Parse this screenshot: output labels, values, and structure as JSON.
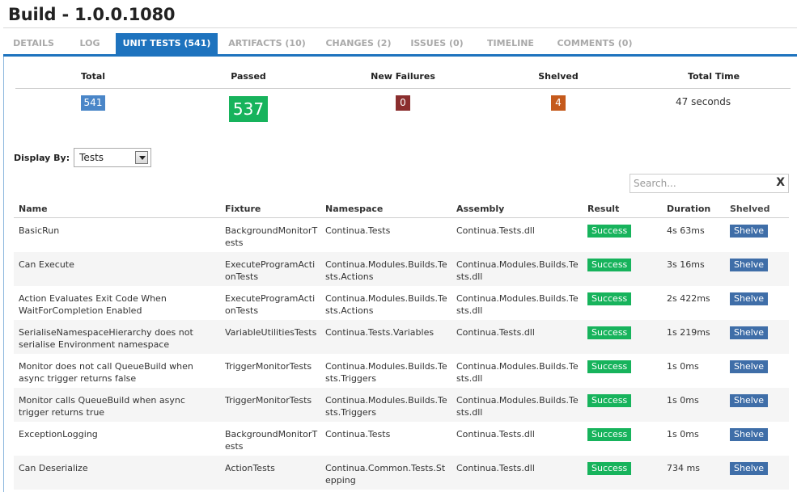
{
  "title": "Build - 1.0.0.1080",
  "tabs": [
    {
      "label": "DETAILS",
      "active": false
    },
    {
      "label": "LOG",
      "active": false
    },
    {
      "label": "UNIT TESTS (541)",
      "active": true
    },
    {
      "label": "ARTIFACTS (10)",
      "active": false
    },
    {
      "label": "CHANGES (2)",
      "active": false
    },
    {
      "label": "ISSUES (0)",
      "active": false
    },
    {
      "label": "TIMELINE",
      "active": false
    },
    {
      "label": "COMMENTS (0)",
      "active": false
    }
  ],
  "summary": {
    "headers": {
      "total": "Total",
      "passed": "Passed",
      "new_failures": "New Failures",
      "shelved": "Shelved",
      "total_time": "Total Time"
    },
    "values": {
      "total": "541",
      "passed": "537",
      "new_failures": "0",
      "shelved": "4",
      "total_time": "47 seconds"
    },
    "colors": {
      "total": "#4a86c8",
      "passed": "#17b35c",
      "new_failures": "#8b2e2e",
      "shelved": "#c55a1c"
    }
  },
  "display_by": {
    "label": "Display By:",
    "selected": "Tests"
  },
  "search": {
    "placeholder": "Search...",
    "clear": "X"
  },
  "table": {
    "columns": {
      "name": "Name",
      "fixture": "Fixture",
      "namespace": "Namespace",
      "assembly": "Assembly",
      "result": "Result",
      "duration": "Duration",
      "shelved": "Shelved"
    },
    "rows": [
      {
        "name": "BasicRun",
        "fixture": "BackgroundMonitorTests",
        "namespace": "Continua.Tests",
        "assembly": "Continua.Tests.dll",
        "result": "Success",
        "duration": "4s 63ms",
        "shelve": "Shelve"
      },
      {
        "name": "Can Execute",
        "fixture": "ExecuteProgramActionTests",
        "namespace": "Continua.Modules.Builds.Tests.Actions",
        "assembly": "Continua.Modules.Builds.Tests.dll",
        "result": "Success",
        "duration": "3s 16ms",
        "shelve": "Shelve"
      },
      {
        "name": "Action Evaluates Exit Code When WaitForCompletion Enabled",
        "fixture": "ExecuteProgramActionTests",
        "namespace": "Continua.Modules.Builds.Tests.Actions",
        "assembly": "Continua.Modules.Builds.Tests.dll",
        "result": "Success",
        "duration": "2s 422ms",
        "shelve": "Shelve"
      },
      {
        "name": "SerialiseNamespaceHierarchy does not serialise Environment namespace",
        "fixture": "VariableUtilitiesTests",
        "namespace": "Continua.Tests.Variables",
        "assembly": "Continua.Tests.dll",
        "result": "Success",
        "duration": "1s 219ms",
        "shelve": "Shelve"
      },
      {
        "name": "Monitor does not call QueueBuild when async trigger returns false",
        "fixture": "TriggerMonitorTests",
        "namespace": "Continua.Modules.Builds.Tests.Triggers",
        "assembly": "Continua.Modules.Builds.Tests.dll",
        "result": "Success",
        "duration": "1s 0ms",
        "shelve": "Shelve"
      },
      {
        "name": "Monitor calls QueueBuild when async trigger returns true",
        "fixture": "TriggerMonitorTests",
        "namespace": "Continua.Modules.Builds.Tests.Triggers",
        "assembly": "Continua.Modules.Builds.Tests.dll",
        "result": "Success",
        "duration": "1s 0ms",
        "shelve": "Shelve"
      },
      {
        "name": "ExceptionLogging",
        "fixture": "BackgroundMonitorTests",
        "namespace": "Continua.Tests",
        "assembly": "Continua.Tests.dll",
        "result": "Success",
        "duration": "1s 0ms",
        "shelve": "Shelve"
      },
      {
        "name": "Can Deserialize",
        "fixture": "ActionTests",
        "namespace": "Continua.Common.Tests.Stepping",
        "assembly": "Continua.Tests.dll",
        "result": "Success",
        "duration": "734 ms",
        "shelve": "Shelve"
      }
    ]
  }
}
